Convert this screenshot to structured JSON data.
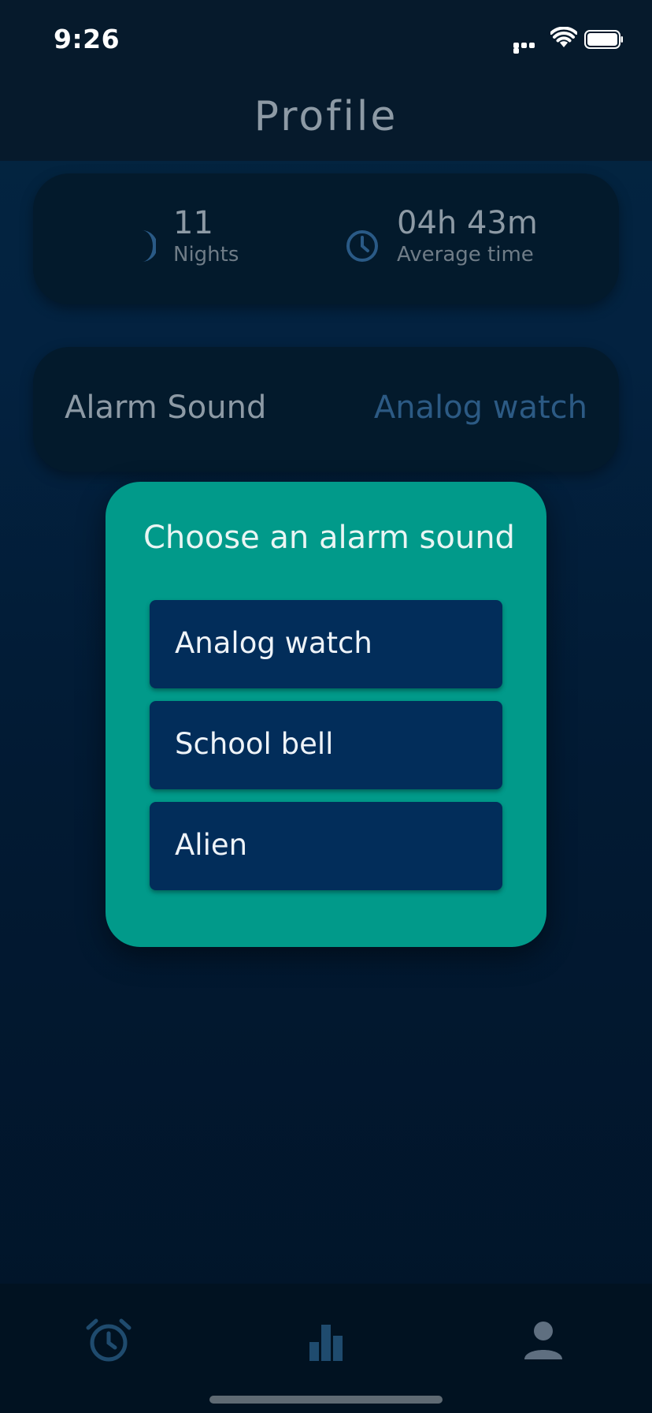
{
  "status_bar": {
    "time": "9:26"
  },
  "header": {
    "title": "Profile"
  },
  "stats": {
    "nights_value": "11",
    "nights_label": "Nights",
    "avg_value": "04h 43m",
    "avg_label": "Average time"
  },
  "alarm_setting": {
    "label": "Alarm Sound",
    "value": "Analog watch"
  },
  "modal": {
    "title": "Choose an alarm sound",
    "options": [
      "Analog watch",
      "School bell",
      "Alien"
    ]
  },
  "icons": {
    "moon": "moon-icon",
    "clock": "clock-icon",
    "tab_alarm": "alarm-clock-icon",
    "tab_stats": "bar-chart-icon",
    "tab_profile": "person-icon"
  },
  "colors": {
    "modal_bg": "#019a8a",
    "option_bg": "#022d5a",
    "accent_link": "#2c5a84",
    "tab_active": "#5f6f80",
    "tab_inactive": "#1f4b6e"
  }
}
